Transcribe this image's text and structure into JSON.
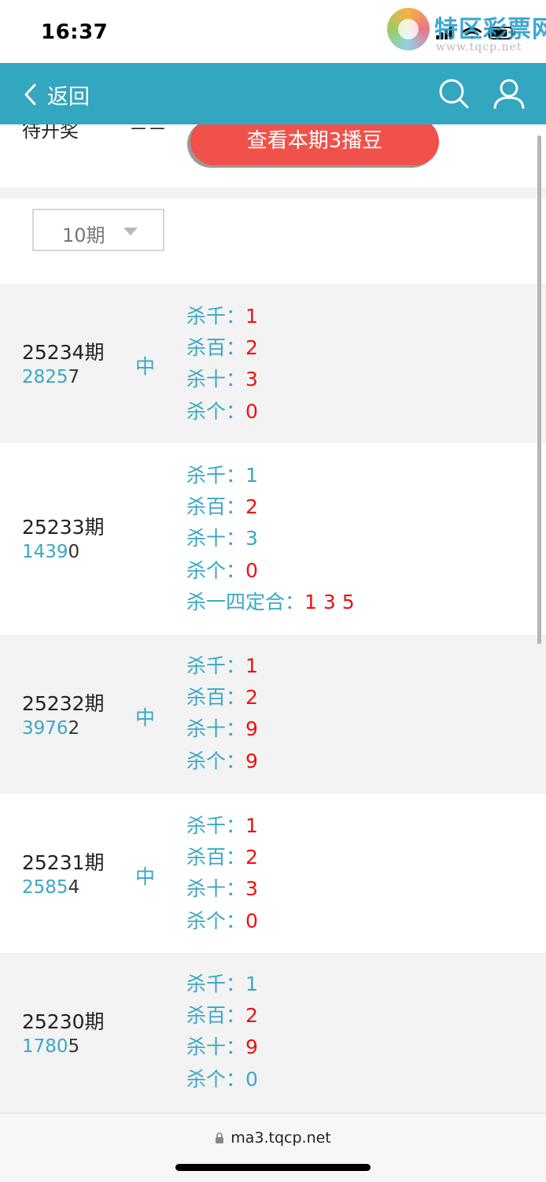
{
  "status": {
    "time": "16:37"
  },
  "watermark": {
    "title": "特区彩票网",
    "url": "www.tqcp.net"
  },
  "nav": {
    "back_label": "返回"
  },
  "top": {
    "pending_label": "待开奖",
    "pending_value": "－－",
    "button_label": "查看本期3播豆"
  },
  "filter": {
    "selected": "10期"
  },
  "records": [
    {
      "period": "25234期",
      "num_colored": "2825",
      "num_last": "7",
      "hit": "中",
      "lines": [
        {
          "label": "杀千：",
          "value": "1",
          "color": "red"
        },
        {
          "label": "杀百：",
          "value": "2",
          "color": "red"
        },
        {
          "label": "杀十：",
          "value": "3",
          "color": "red"
        },
        {
          "label": "杀个：",
          "value": "0",
          "color": "red"
        }
      ]
    },
    {
      "period": "25233期",
      "num_colored": "1439",
      "num_last": "0",
      "hit": "",
      "lines": [
        {
          "label": "杀千：",
          "value": "1",
          "color": "blue"
        },
        {
          "label": "杀百：",
          "value": "2",
          "color": "red"
        },
        {
          "label": "杀十：",
          "value": "3",
          "color": "blue"
        },
        {
          "label": "杀个：",
          "value": "0",
          "color": "red"
        },
        {
          "label": "杀一四定合：",
          "value": "1 3 5",
          "color": "red"
        }
      ]
    },
    {
      "period": "25232期",
      "num_colored": "3976",
      "num_last": "2",
      "hit": "中",
      "lines": [
        {
          "label": "杀千：",
          "value": "1",
          "color": "red"
        },
        {
          "label": "杀百：",
          "value": "2",
          "color": "red"
        },
        {
          "label": "杀十：",
          "value": "9",
          "color": "red"
        },
        {
          "label": "杀个：",
          "value": "9",
          "color": "red"
        }
      ]
    },
    {
      "period": "25231期",
      "num_colored": "2585",
      "num_last": "4",
      "hit": "中",
      "lines": [
        {
          "label": "杀千：",
          "value": "1",
          "color": "red"
        },
        {
          "label": "杀百：",
          "value": "2",
          "color": "red"
        },
        {
          "label": "杀十：",
          "value": "3",
          "color": "red"
        },
        {
          "label": "杀个：",
          "value": "0",
          "color": "red"
        }
      ]
    },
    {
      "period": "25230期",
      "num_colored": "1780",
      "num_last": "5",
      "hit": "",
      "lines": [
        {
          "label": "杀千：",
          "value": "1",
          "color": "blue"
        },
        {
          "label": "杀百：",
          "value": "2",
          "color": "red"
        },
        {
          "label": "杀十：",
          "value": "9",
          "color": "red"
        },
        {
          "label": "杀个：",
          "value": "0",
          "color": "blue"
        }
      ]
    }
  ],
  "browser": {
    "url": "ma3.tqcp.net"
  }
}
